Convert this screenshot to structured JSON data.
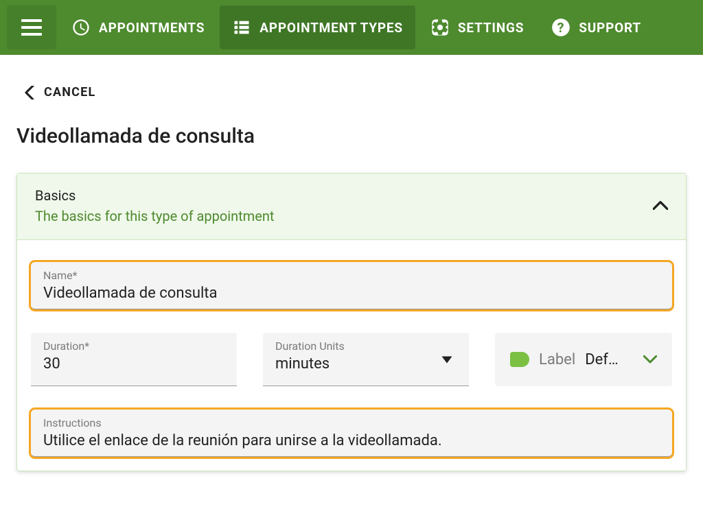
{
  "topnav": {
    "items": [
      {
        "label": "APPOINTMENTS"
      },
      {
        "label": "APPOINTMENT TYPES"
      },
      {
        "label": "SETTINGS"
      },
      {
        "label": "SUPPORT"
      }
    ]
  },
  "cancel": {
    "label": "CANCEL"
  },
  "page": {
    "title": "Videollamada de consulta"
  },
  "panel": {
    "title": "Basics",
    "subtitle": "The basics for this type of appointment"
  },
  "fields": {
    "name": {
      "label": "Name*",
      "value": "Videollamada de consulta"
    },
    "duration": {
      "label": "Duration*",
      "value": "30"
    },
    "units": {
      "label": "Duration Units",
      "value": "minutes"
    },
    "labelField": {
      "label": "Label",
      "value": "Def…"
    },
    "instructions": {
      "label": "Instructions",
      "value": "Utilice el enlace de la reunión para unirse a la videollamada."
    }
  }
}
